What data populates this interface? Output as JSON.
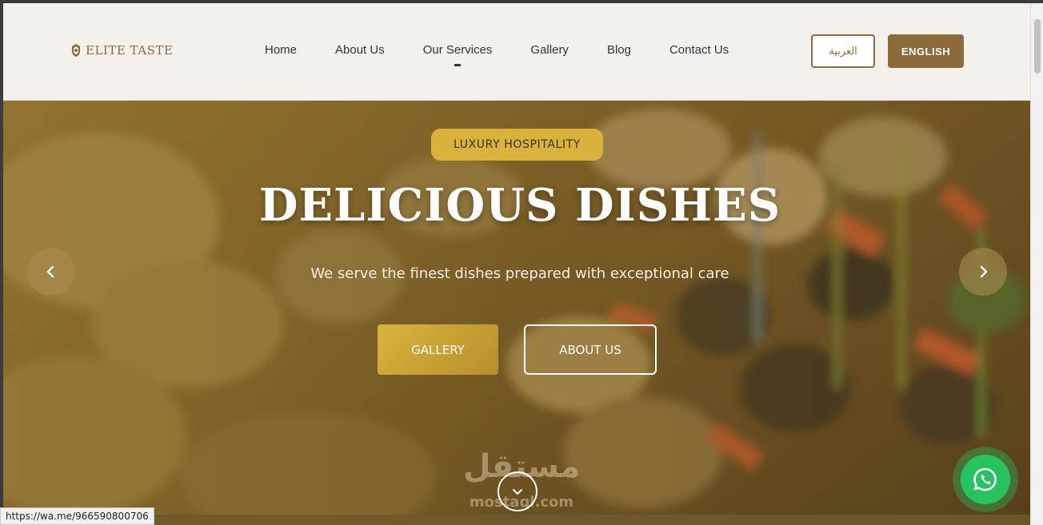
{
  "header": {
    "logo_text": "ELITE TASTE",
    "nav": [
      {
        "label": "Home"
      },
      {
        "label": "About Us"
      },
      {
        "label": "Our Services"
      },
      {
        "label": "Gallery"
      },
      {
        "label": "Blog"
      },
      {
        "label": "Contact Us"
      }
    ],
    "lang_ar_label": "العربية",
    "lang_en_label": "ENGLISH"
  },
  "hero": {
    "badge": "LUXURY HOSPITALITY",
    "title": "DELICIOUS DISHES",
    "subtitle": "We serve the finest dishes prepared with exceptional care",
    "gallery_label": "GALLERY",
    "about_label": "ABOUT US"
  },
  "watermark": {
    "arabic": "مستقل",
    "latin": "mostaql.com"
  },
  "status_bar": {
    "url": "https://wa.me/966590800706"
  },
  "colors": {
    "brand": "#8c6a3c",
    "accent": "#d8b23a",
    "whatsapp": "#25c45f"
  },
  "icons": {
    "prev": "chevron-left-icon",
    "next": "chevron-right-icon",
    "scroll": "chevron-down-icon",
    "chat": "whatsapp-icon"
  }
}
